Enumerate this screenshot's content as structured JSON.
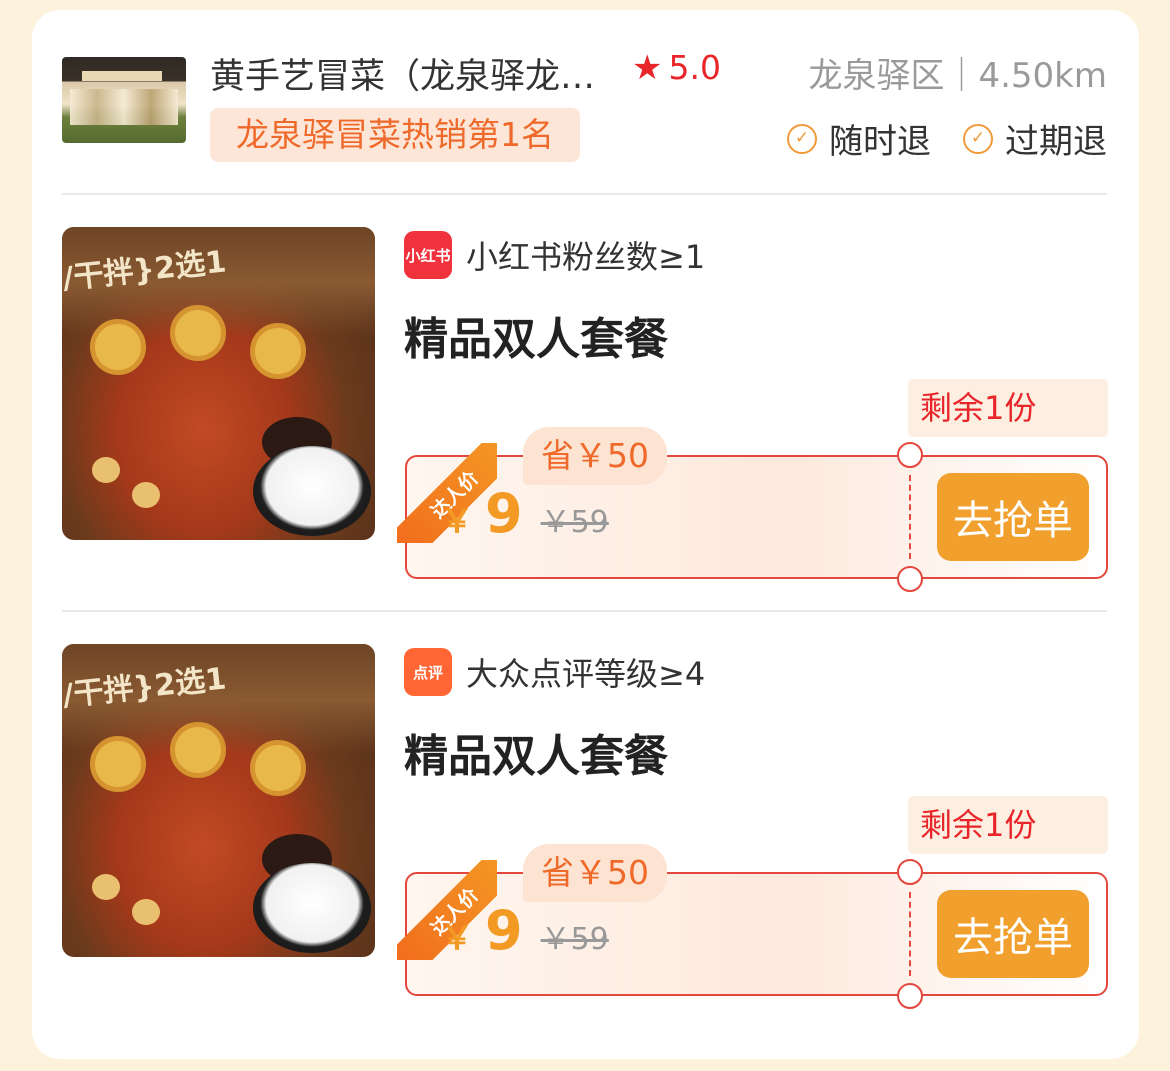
{
  "store": {
    "name": "黄手艺冒菜（龙泉驿龙…",
    "rating": "5.0",
    "location": "龙泉驿区｜4.50km",
    "rank_badge": "龙泉驿冒菜热销第1名",
    "refund_any_time": "随时退",
    "refund_expired": "过期退",
    "star_icon": "star-icon",
    "check_icon": "check-circle-icon"
  },
  "deals": [
    {
      "platform_logo_text": "小红书",
      "platform_color": "#f0323c",
      "requirement": "小红书粉丝数≥1",
      "title": "精品双人套餐",
      "image_text": "/干拌}2选1",
      "remaining": "剩余1份",
      "ribbon": "达人价",
      "save": "省￥50",
      "currency": "￥",
      "price": "9",
      "original_price": "￥59",
      "button": "去抢单"
    },
    {
      "platform_logo_text": "点评",
      "platform_color": "#ff6633",
      "requirement": "大众点评等级≥4",
      "title": "精品双人套餐",
      "image_text": "/干拌}2选1",
      "remaining": "剩余1份",
      "ribbon": "达人价",
      "save": "省￥50",
      "currency": "￥",
      "price": "9",
      "original_price": "￥59",
      "button": "去抢单"
    }
  ]
}
